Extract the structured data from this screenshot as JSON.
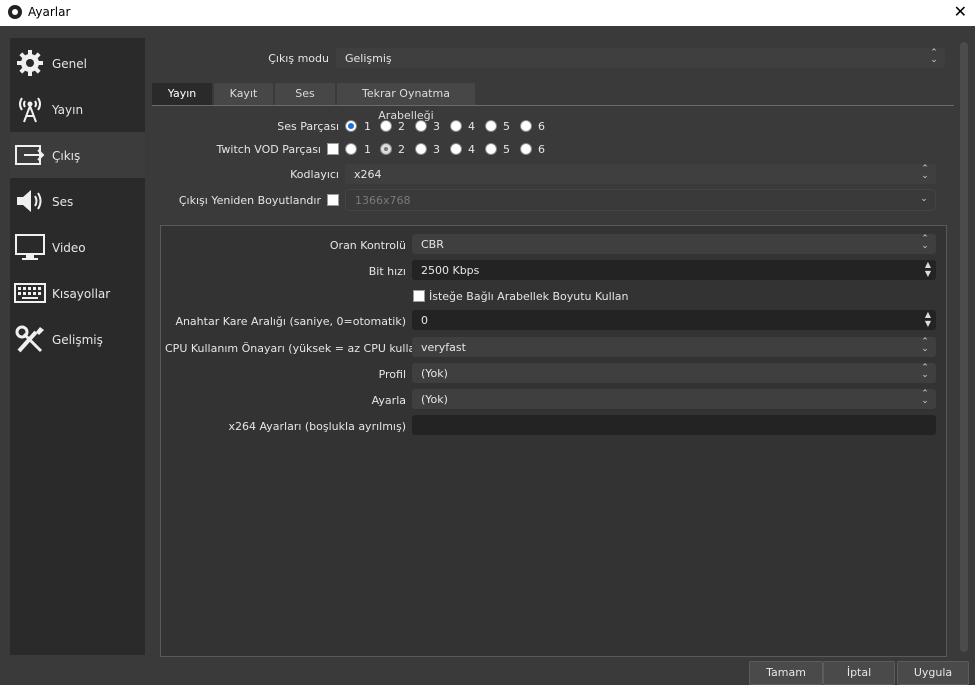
{
  "window": {
    "title": "Ayarlar",
    "close_glyph": "✕"
  },
  "sidebar": {
    "items": [
      {
        "label": "Genel",
        "icon": "gear-icon"
      },
      {
        "label": "Yayın",
        "icon": "broadcast-icon"
      },
      {
        "label": "Çıkış",
        "icon": "output-icon"
      },
      {
        "label": "Ses",
        "icon": "speaker-icon"
      },
      {
        "label": "Video",
        "icon": "monitor-icon"
      },
      {
        "label": "Kısayollar",
        "icon": "keyboard-icon"
      },
      {
        "label": "Gelişmiş",
        "icon": "tools-icon"
      }
    ],
    "active_index": 2
  },
  "output_mode": {
    "label": "Çıkış modu",
    "value": "Gelişmiş"
  },
  "tabs": [
    "Yayın",
    "Kayıt",
    "Ses",
    "Tekrar Oynatma Arabelleği"
  ],
  "audio_track": {
    "label": "Ses Parçası",
    "options": [
      "1",
      "2",
      "3",
      "4",
      "5",
      "6"
    ],
    "selected": "1"
  },
  "twitch_vod": {
    "label": "Twitch VOD Parçası",
    "options": [
      "1",
      "2",
      "3",
      "4",
      "5",
      "6"
    ],
    "selected": "2",
    "checked": false
  },
  "encoder": {
    "label": "Kodlayıcı",
    "value": "x264"
  },
  "rescale": {
    "label": "Çıkışı Yeniden Boyutlandır",
    "value": "1366x768",
    "checked": false
  },
  "settings": {
    "rate_control": {
      "label": "Oran Kontrolü",
      "value": "CBR"
    },
    "bitrate": {
      "label": "Bit hızı",
      "value": "2500 Kbps"
    },
    "custom_buffer": {
      "label": "İsteğe Bağlı Arabellek Boyutu Kullan",
      "checked": false
    },
    "keyframe": {
      "label": "Anahtar Kare Aralığı (saniye, 0=otomatik)",
      "value": "0"
    },
    "cpu_preset": {
      "label": "CPU Kullanım Önayarı (yüksek = az CPU kullanımı)",
      "value": "veryfast"
    },
    "profile": {
      "label": "Profil",
      "value": "(Yok)"
    },
    "tune": {
      "label": "Ayarla",
      "value": "(Yok)"
    },
    "x264_opts": {
      "label": "x264 Ayarları (boşlukla ayrılmış)",
      "value": ""
    }
  },
  "buttons": {
    "ok": "Tamam",
    "cancel": "İptal",
    "apply": "Uygula"
  }
}
